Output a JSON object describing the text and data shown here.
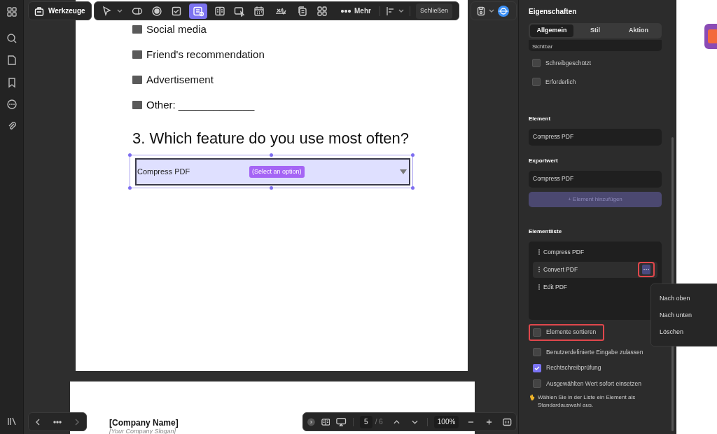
{
  "toolbar": {
    "tools_button": "Werkzeuge",
    "tools": [
      {
        "kind": "pointer",
        "selected": false
      },
      {
        "kind": "button",
        "selected": false
      },
      {
        "kind": "radio",
        "selected": false
      },
      {
        "kind": "checkbox",
        "selected": false
      },
      {
        "kind": "combo",
        "selected": true
      },
      {
        "kind": "list",
        "selected": false
      },
      {
        "kind": "image",
        "selected": false
      },
      {
        "kind": "date",
        "selected": false
      },
      {
        "kind": "signature",
        "selected": false
      },
      {
        "kind": "copy",
        "selected": false
      },
      {
        "kind": "grid",
        "selected": false
      }
    ],
    "more": "Mehr",
    "close": "Schließen"
  },
  "document": {
    "options": [
      "Social media",
      "Friend's recommendation",
      "Advertisement",
      "Other: _____________"
    ],
    "question": "3. Which feature do you use most often?",
    "dropdown": {
      "value": "Compress PDF",
      "placeholder": "(Select an option)"
    },
    "next_page": {
      "company": "[Company Name]",
      "slogan": "[Your Company Slogan]"
    }
  },
  "properties": {
    "title": "Eigenschaften",
    "tabs": [
      {
        "label": "Allgemein",
        "selected": true
      },
      {
        "label": "Stil",
        "selected": false
      },
      {
        "label": "Aktion",
        "selected": false
      }
    ],
    "visibility": "Sichtbar",
    "flags": [
      {
        "label": "Schreibgeschützt",
        "checked": false
      },
      {
        "label": "Erforderlich",
        "checked": false
      }
    ],
    "element_label": "Element",
    "element_value": "Compress PDF",
    "export_label": "Exportwert",
    "export_value": "Compress PDF",
    "add_button": "+ Element hinzufügen",
    "list_label": "Elementliste",
    "items": [
      {
        "label": "Compress PDF",
        "selected": false
      },
      {
        "label": "Convert PDF",
        "selected": true
      },
      {
        "label": "Edit PDF",
        "selected": false
      }
    ],
    "menu": [
      "Nach oben",
      "Nach unten",
      "Löschen"
    ],
    "options": [
      {
        "label": "Elemente sortieren",
        "checked": false,
        "highlighted": true
      },
      {
        "label": "Benutzerdefinierte Eingabe zulassen",
        "checked": false,
        "highlighted": false
      },
      {
        "label": "Rechtschreibprüfung",
        "checked": true,
        "highlighted": false
      },
      {
        "label": "Ausgewählten Wert sofort einsetzen",
        "checked": false,
        "highlighted": false
      }
    ],
    "hint": "Wählen Sie in der Liste ein Element als Standardauswahl aus."
  },
  "page_nav": {
    "page": "5",
    "total": "/ 6",
    "zoom": "100%"
  }
}
